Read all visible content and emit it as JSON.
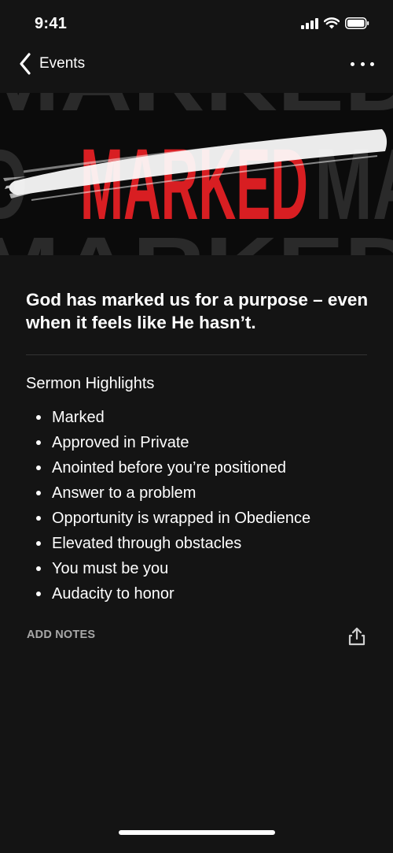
{
  "status_bar": {
    "time": "9:41",
    "icons": [
      "signal-icon",
      "wifi-icon",
      "battery-icon"
    ]
  },
  "nav": {
    "back_label": "Events",
    "back_icon": "chevron-left-icon",
    "more_icon": "more-horizontal-icon"
  },
  "banner": {
    "word": "MARKED",
    "accent_color": "#d81e22",
    "background_color": "#0b0b0b"
  },
  "content": {
    "headline": "God has marked us for a purpose – even when it feels like He hasn’t.",
    "section_title": "Sermon Highlights",
    "highlights": [
      "Marked",
      "Approved in Private",
      "Anointed before you’re positioned",
      "Answer to a problem",
      "Opportunity is wrapped in Obedience",
      "Elevated through obstacles",
      "You must be you",
      "Audacity to honor"
    ]
  },
  "actions": {
    "add_notes_label": "ADD NOTES",
    "share_icon": "share-icon"
  }
}
